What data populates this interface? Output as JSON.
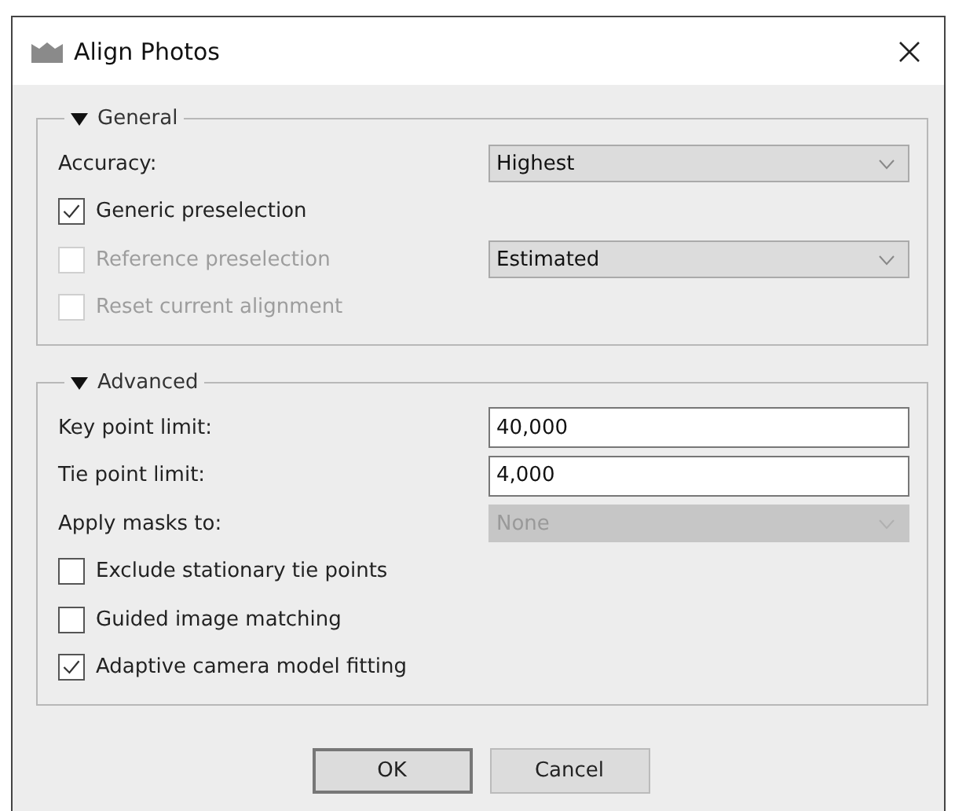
{
  "window": {
    "title": "Align Photos"
  },
  "sections": [
    {
      "title": "General",
      "expanded": true,
      "rows": [
        {
          "kind": "dropdown",
          "label": "Accuracy:",
          "value": "Highest",
          "disabled": false
        },
        {
          "kind": "checkbox",
          "label": "Generic preselection",
          "checked": true,
          "disabled": false
        },
        {
          "kind": "checkbox-dropdown",
          "label": "Reference preselection",
          "checked": false,
          "disabled": true,
          "value": "Estimated",
          "value_disabled": false
        },
        {
          "kind": "checkbox",
          "label": "Reset current alignment",
          "checked": false,
          "disabled": true
        }
      ]
    },
    {
      "title": "Advanced",
      "expanded": true,
      "rows": [
        {
          "kind": "text-field",
          "label": "Key point limit:",
          "value": "40,000"
        },
        {
          "kind": "text-field",
          "label": "Tie point limit:",
          "value": "4,000"
        },
        {
          "kind": "dropdown",
          "label": "Apply masks to:",
          "value": "None",
          "disabled": true
        },
        {
          "kind": "checkbox",
          "label": "Exclude stationary tie points",
          "checked": false,
          "disabled": false
        },
        {
          "kind": "checkbox",
          "label": "Guided image matching",
          "checked": false,
          "disabled": false
        },
        {
          "kind": "checkbox",
          "label": "Adaptive camera model fitting",
          "checked": true,
          "disabled": false
        }
      ]
    }
  ],
  "buttons": [
    {
      "label": "OK",
      "default": true
    },
    {
      "label": "Cancel",
      "default": false
    }
  ]
}
